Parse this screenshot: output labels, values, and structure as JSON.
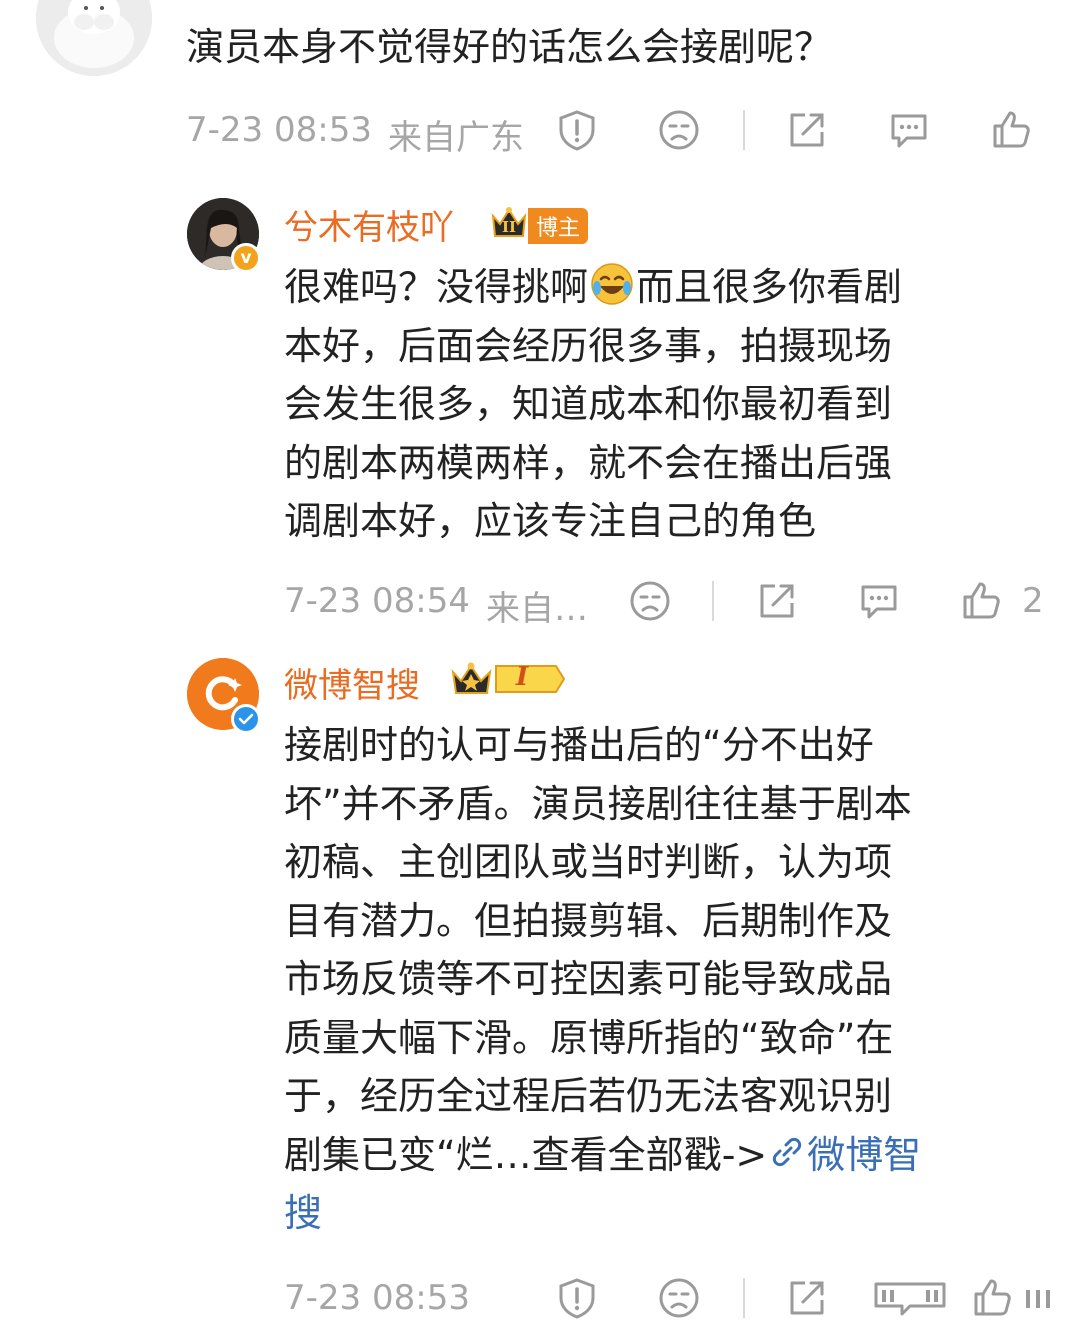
{
  "comment1": {
    "text": "演员本身不觉得好的话怎么会接剧呢？",
    "time": "7-23 08:53",
    "location": "来自广东",
    "icons": [
      "report-icon",
      "dislike-icon",
      "share-icon",
      "reply-icon",
      "like-icon"
    ]
  },
  "reply1": {
    "username": "兮木有枝吖",
    "level_badge": "II",
    "role_badge": "博主",
    "verified_badge": "v",
    "lines": [
      "很难吗？没得挑啊",
      "而且很多你看剧",
      "本好，后面会经历很多事，拍摄现场",
      "会发生很多，知道成本和你最初看到",
      "的剧本两模两样，就不会在播出后强",
      "调剧本好，应该专注自己的角色"
    ],
    "emoji": "laugh-cry-emoji",
    "time": "7-23 08:54",
    "location": "来自…",
    "like_count": "2"
  },
  "reply2": {
    "username": "微博智搜",
    "level_badge": "I",
    "lines": [
      "接剧时的认可与播出后的“分不出好",
      "坏”并不矛盾。演员接剧往往基于剧本",
      "初稿、主创团队或当时判断，认为项",
      "目有潜力。但拍摄剪辑、后期制作及",
      "市场反馈等不可控因素可能导致成品",
      "质量大幅下滑。原博所指的“致命”在",
      "于，经历全过程后若仍无法客观识别",
      "剧集已变“烂…查看全部戳->"
    ],
    "link_text": "微博智",
    "link_text_tail": "搜",
    "time": "7-23 08:53"
  },
  "colors": {
    "accent": "#ea6c22",
    "link": "#3b6fb5",
    "meta": "#a6a6a6",
    "text": "#222222"
  }
}
